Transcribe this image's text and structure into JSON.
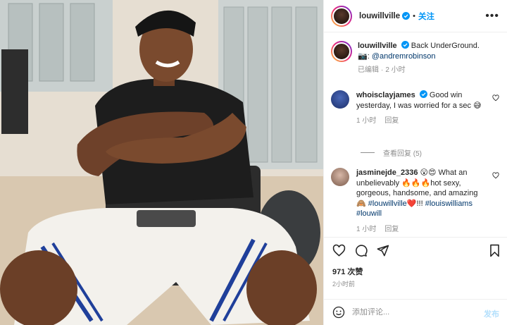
{
  "header": {
    "username": "louwillville",
    "separator": "•",
    "follow_label": "关注",
    "more_label": "•••"
  },
  "caption": {
    "username": "louwillville",
    "text": "Back UnderGround.",
    "credit_prefix": "📷: ",
    "credit_handle": "@andremrobinson",
    "edited": "已编辑",
    "separator": "·",
    "time": "2 小时"
  },
  "comments": [
    {
      "username": "whoisclayjames",
      "text": "Good win yesterday, I was worried for a sec 😅",
      "time": "1 小时",
      "reply_label": "回复",
      "view_replies": "查看回复 (5)"
    },
    {
      "username": "jasminejde_2336",
      "text_a": "😮😍 What an unbelievably 🔥🔥🔥hot sexy, gorgeous, handsome, and amazing 🙈",
      "mention": "#louwillville",
      "text_b": "❤️!!!",
      "tags": "#louiswilliams #louwill",
      "time": "1 小时",
      "reply_label": "回复"
    }
  ],
  "actions": {
    "likes": "971 次赞",
    "posted_time": "2小时前"
  },
  "composer": {
    "placeholder": "添加评论...",
    "post_label": "发布"
  },
  "colors": {
    "accent": "#0095f6",
    "link": "#00376b",
    "muted": "#8e8e8e",
    "text": "#262626"
  },
  "icons": [
    "verified-icon",
    "more-icon",
    "heart-icon",
    "comment-icon",
    "share-icon",
    "bookmark-icon",
    "emoji-icon"
  ]
}
